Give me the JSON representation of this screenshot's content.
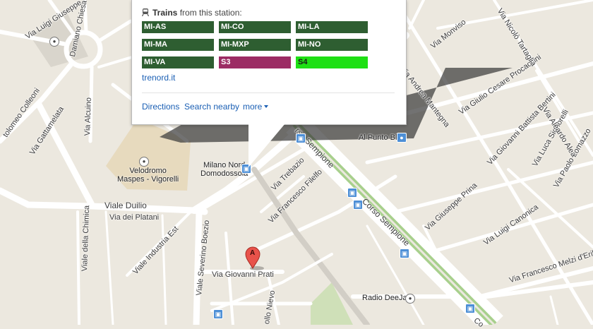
{
  "map": {
    "streets": {
      "luigi_giuseppe": "Via Luigi Giuseppe",
      "damiano_chiesa": "Damiano Chiesa",
      "colleoni": "tolomeo Colleoni",
      "gattamelata": "Via Gattamelata",
      "alcuino": "Via Alcuino",
      "duilio": "Viale Duilio",
      "platani": "Via dei Platani",
      "chimica": "Viale della Chimica",
      "industria": "Viale Industria Est",
      "severino_boezio": "Viale Severino Boezio",
      "giovanni_prati": "Via Giovanni Prati",
      "nievo": "ollo Nievo",
      "trebazio": "Via Trebazio",
      "francesco_filelfo": "Via Francesco Filelfo",
      "corso_sempione": "Corso Sempione",
      "sempione_top": "rso Sempione",
      "giuseppe_prina": "Via Giuseppe Prina",
      "luigi_canonica": "Via Luigi Canonica",
      "melzi": "Via Francesco Melzi d'Eril",
      "procaccini": "Via Giulio Cesare Procaccini",
      "mantegna": "Via Andrea Mantegna",
      "monviso": "Via Monviso",
      "tartaglia": "Via Nicolò Tartaglia",
      "bertini": "Via Giovanni Battista Bertini",
      "signorelli": "Via Luca Signorelli",
      "lomazzo": "Via Paolo Lomazzo",
      "aleardo": "Via Aleardo Alea",
      "messina": "Via",
      "co": "Co"
    },
    "places": {
      "velodromo": "Velodromo\nMaspes - Vigorelli",
      "milano_nord": "Milano Nord\nDomodossola",
      "al_punto_blu": "Al Punto Blu",
      "radio_deejay": "Radio DeeJay"
    },
    "marker_letter": "A"
  },
  "popup": {
    "trains_label": "Trains",
    "trains_suffix": "from this station:",
    "lines": [
      {
        "label": "MI-AS",
        "bg": "#2e5e31",
        "fg": "#ffffff"
      },
      {
        "label": "MI-CO",
        "bg": "#2e5e31",
        "fg": "#ffffff"
      },
      {
        "label": "MI-LA",
        "bg": "#2e5e31",
        "fg": "#ffffff"
      },
      {
        "label": "MI-MA",
        "bg": "#2e5e31",
        "fg": "#ffffff"
      },
      {
        "label": "MI-MXP",
        "bg": "#2e5e31",
        "fg": "#ffffff"
      },
      {
        "label": "MI-NO",
        "bg": "#2e5e31",
        "fg": "#ffffff"
      },
      {
        "label": "MI-VA",
        "bg": "#2e5e31",
        "fg": "#ffffff"
      },
      {
        "label": "S3",
        "bg": "#9c2c64",
        "fg": "#ffffff"
      },
      {
        "label": "S4",
        "bg": "#1ee014",
        "fg": "#1a1a1a"
      }
    ],
    "operator_link": "trenord.it",
    "actions": {
      "directions": "Directions",
      "search_nearby": "Search nearby",
      "more": "more"
    }
  },
  "colors": {
    "land": "#ece8df",
    "road": "#ffffff",
    "park": "#cfe0b8",
    "velodromo": "#e6d7b9",
    "corso_green": "#a8d08d",
    "link": "#1a5fb4"
  }
}
